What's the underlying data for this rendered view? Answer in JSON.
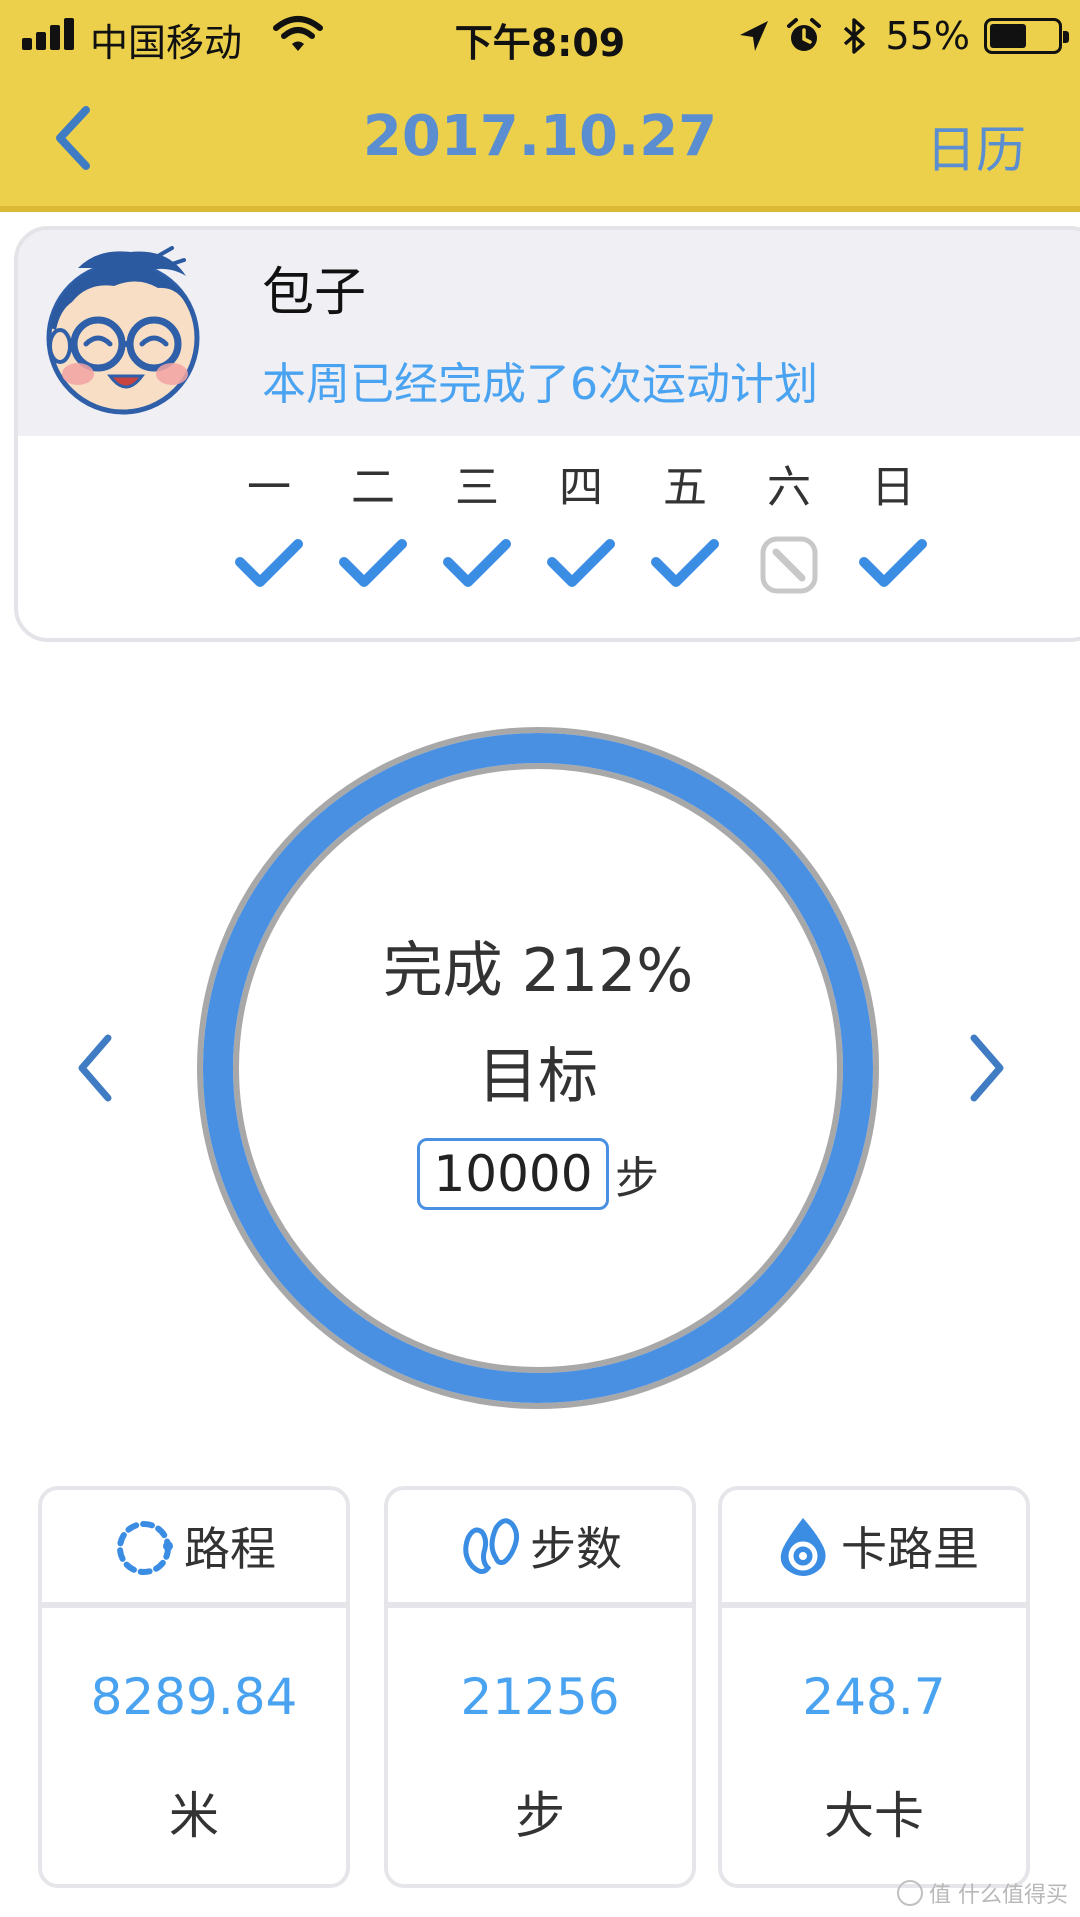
{
  "status_bar": {
    "carrier": "中国移动",
    "time": "下午8:09",
    "battery_percent_text": "55%",
    "battery_level": 0.55,
    "signal_bars": 4,
    "icons": [
      "signal-icon",
      "wifi-icon",
      "location-arrow-icon",
      "alarm-icon",
      "bluetooth-icon",
      "battery-icon"
    ]
  },
  "nav": {
    "title": "2017.10.27",
    "right_label": "日历",
    "back_icon": "chevron-left-icon"
  },
  "profile": {
    "name": "包子",
    "summary": "本周已经完成了6次运动计划",
    "week": [
      {
        "label": "一",
        "status": "done"
      },
      {
        "label": "二",
        "status": "done"
      },
      {
        "label": "三",
        "status": "done"
      },
      {
        "label": "四",
        "status": "done"
      },
      {
        "label": "五",
        "status": "done"
      },
      {
        "label": "六",
        "status": "skipped"
      },
      {
        "label": "日",
        "status": "done"
      }
    ]
  },
  "progress": {
    "complete_text": "完成 212%",
    "goal_label": "目标",
    "goal_value": "10000",
    "goal_unit": "步",
    "ring_fraction": 1.0
  },
  "stats": [
    {
      "title": "路程",
      "icon": "route-icon",
      "value": "8289.84",
      "unit": "米"
    },
    {
      "title": "步数",
      "icon": "footprints-icon",
      "value": "21256",
      "unit": "步"
    },
    {
      "title": "卡路里",
      "icon": "flame-drop-icon",
      "value": "248.7",
      "unit": "大卡"
    }
  ],
  "watermark": "值 什么值得买",
  "colors": {
    "header_bg": "#ecd04b",
    "accent_blue": "#4a90e2",
    "value_blue": "#4aa3f0",
    "title_blue": "#5b8ed0",
    "skipped_gray": "#c8c8c8",
    "ring_track_gray": "#a8a8a8"
  }
}
